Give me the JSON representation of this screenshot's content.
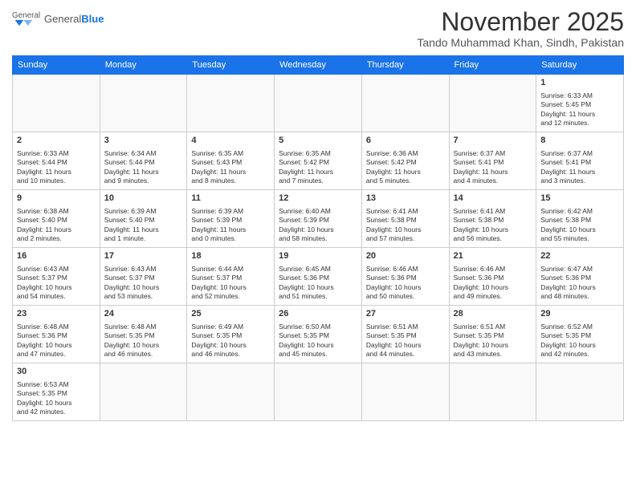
{
  "header": {
    "logo_general": "General",
    "logo_blue": "Blue",
    "month_title": "November 2025",
    "subtitle": "Tando Muhammad Khan, Sindh, Pakistan"
  },
  "weekdays": [
    "Sunday",
    "Monday",
    "Tuesday",
    "Wednesday",
    "Thursday",
    "Friday",
    "Saturday"
  ],
  "weeks": [
    [
      {
        "day": "",
        "info": ""
      },
      {
        "day": "",
        "info": ""
      },
      {
        "day": "",
        "info": ""
      },
      {
        "day": "",
        "info": ""
      },
      {
        "day": "",
        "info": ""
      },
      {
        "day": "",
        "info": ""
      },
      {
        "day": "1",
        "info": "Sunrise: 6:33 AM\nSunset: 5:45 PM\nDaylight: 11 hours\nand 12 minutes."
      }
    ],
    [
      {
        "day": "2",
        "info": "Sunrise: 6:33 AM\nSunset: 5:44 PM\nDaylight: 11 hours\nand 10 minutes."
      },
      {
        "day": "3",
        "info": "Sunrise: 6:34 AM\nSunset: 5:44 PM\nDaylight: 11 hours\nand 9 minutes."
      },
      {
        "day": "4",
        "info": "Sunrise: 6:35 AM\nSunset: 5:43 PM\nDaylight: 11 hours\nand 8 minutes."
      },
      {
        "day": "5",
        "info": "Sunrise: 6:35 AM\nSunset: 5:42 PM\nDaylight: 11 hours\nand 7 minutes."
      },
      {
        "day": "6",
        "info": "Sunrise: 6:36 AM\nSunset: 5:42 PM\nDaylight: 11 hours\nand 5 minutes."
      },
      {
        "day": "7",
        "info": "Sunrise: 6:37 AM\nSunset: 5:41 PM\nDaylight: 11 hours\nand 4 minutes."
      },
      {
        "day": "8",
        "info": "Sunrise: 6:37 AM\nSunset: 5:41 PM\nDaylight: 11 hours\nand 3 minutes."
      }
    ],
    [
      {
        "day": "9",
        "info": "Sunrise: 6:38 AM\nSunset: 5:40 PM\nDaylight: 11 hours\nand 2 minutes."
      },
      {
        "day": "10",
        "info": "Sunrise: 6:39 AM\nSunset: 5:40 PM\nDaylight: 11 hours\nand 1 minute."
      },
      {
        "day": "11",
        "info": "Sunrise: 6:39 AM\nSunset: 5:39 PM\nDaylight: 11 hours\nand 0 minutes."
      },
      {
        "day": "12",
        "info": "Sunrise: 6:40 AM\nSunset: 5:39 PM\nDaylight: 10 hours\nand 58 minutes."
      },
      {
        "day": "13",
        "info": "Sunrise: 6:41 AM\nSunset: 5:38 PM\nDaylight: 10 hours\nand 57 minutes."
      },
      {
        "day": "14",
        "info": "Sunrise: 6:41 AM\nSunset: 5:38 PM\nDaylight: 10 hours\nand 56 minutes."
      },
      {
        "day": "15",
        "info": "Sunrise: 6:42 AM\nSunset: 5:38 PM\nDaylight: 10 hours\nand 55 minutes."
      }
    ],
    [
      {
        "day": "16",
        "info": "Sunrise: 6:43 AM\nSunset: 5:37 PM\nDaylight: 10 hours\nand 54 minutes."
      },
      {
        "day": "17",
        "info": "Sunrise: 6:43 AM\nSunset: 5:37 PM\nDaylight: 10 hours\nand 53 minutes."
      },
      {
        "day": "18",
        "info": "Sunrise: 6:44 AM\nSunset: 5:37 PM\nDaylight: 10 hours\nand 52 minutes."
      },
      {
        "day": "19",
        "info": "Sunrise: 6:45 AM\nSunset: 5:36 PM\nDaylight: 10 hours\nand 51 minutes."
      },
      {
        "day": "20",
        "info": "Sunrise: 6:46 AM\nSunset: 5:36 PM\nDaylight: 10 hours\nand 50 minutes."
      },
      {
        "day": "21",
        "info": "Sunrise: 6:46 AM\nSunset: 5:36 PM\nDaylight: 10 hours\nand 49 minutes."
      },
      {
        "day": "22",
        "info": "Sunrise: 6:47 AM\nSunset: 5:36 PM\nDaylight: 10 hours\nand 48 minutes."
      }
    ],
    [
      {
        "day": "23",
        "info": "Sunrise: 6:48 AM\nSunset: 5:36 PM\nDaylight: 10 hours\nand 47 minutes."
      },
      {
        "day": "24",
        "info": "Sunrise: 6:48 AM\nSunset: 5:35 PM\nDaylight: 10 hours\nand 46 minutes."
      },
      {
        "day": "25",
        "info": "Sunrise: 6:49 AM\nSunset: 5:35 PM\nDaylight: 10 hours\nand 46 minutes."
      },
      {
        "day": "26",
        "info": "Sunrise: 6:50 AM\nSunset: 5:35 PM\nDaylight: 10 hours\nand 45 minutes."
      },
      {
        "day": "27",
        "info": "Sunrise: 6:51 AM\nSunset: 5:35 PM\nDaylight: 10 hours\nand 44 minutes."
      },
      {
        "day": "28",
        "info": "Sunrise: 6:51 AM\nSunset: 5:35 PM\nDaylight: 10 hours\nand 43 minutes."
      },
      {
        "day": "29",
        "info": "Sunrise: 6:52 AM\nSunset: 5:35 PM\nDaylight: 10 hours\nand 42 minutes."
      }
    ],
    [
      {
        "day": "30",
        "info": "Sunrise: 6:53 AM\nSunset: 5:35 PM\nDaylight: 10 hours\nand 42 minutes."
      },
      {
        "day": "",
        "info": ""
      },
      {
        "day": "",
        "info": ""
      },
      {
        "day": "",
        "info": ""
      },
      {
        "day": "",
        "info": ""
      },
      {
        "day": "",
        "info": ""
      },
      {
        "day": "",
        "info": ""
      }
    ]
  ]
}
